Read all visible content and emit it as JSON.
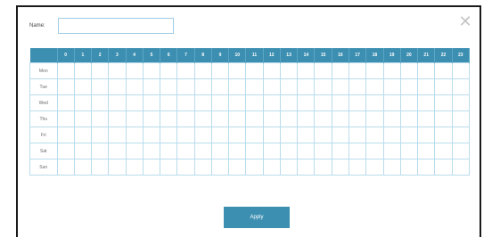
{
  "dialog": {
    "name_label": "Name:",
    "name_value": "",
    "close_glyph": "✕",
    "apply_label": "Apply"
  },
  "schedule": {
    "hours": [
      "0",
      "1",
      "2",
      "3",
      "4",
      "5",
      "6",
      "7",
      "8",
      "9",
      "10",
      "11",
      "12",
      "13",
      "14",
      "15",
      "16",
      "17",
      "18",
      "19",
      "20",
      "21",
      "22",
      "23"
    ],
    "days": [
      "Mon",
      "Tue",
      "Wed",
      "Thu",
      "Fri",
      "Sat",
      "Sun"
    ]
  },
  "colors": {
    "accent": "#3c8fb1",
    "grid_line": "#b9dcec",
    "input_border": "#9ecde6"
  }
}
